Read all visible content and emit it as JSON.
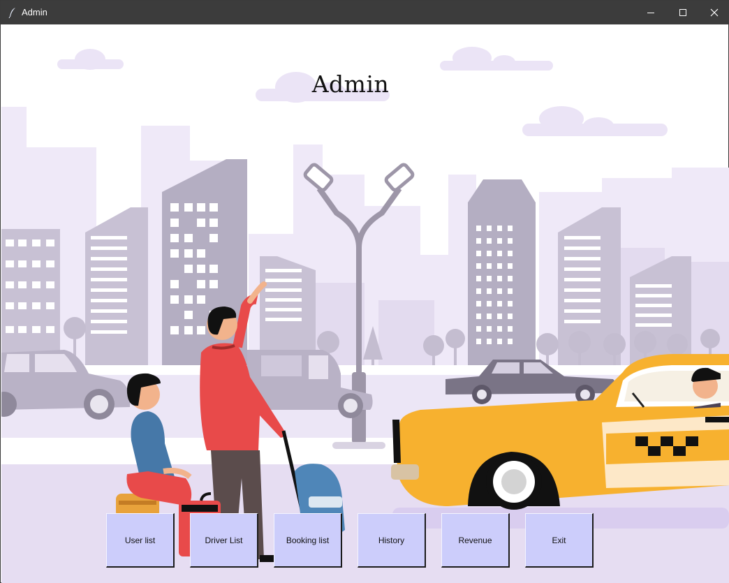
{
  "window": {
    "title": "Admin",
    "controls": {
      "minimize": "minimize-icon",
      "maximize": "maximize-icon",
      "close": "close-icon"
    }
  },
  "page": {
    "heading": "Admin"
  },
  "buttons": [
    {
      "label": "User list"
    },
    {
      "label": "Driver List"
    },
    {
      "label": "Booking list"
    },
    {
      "label": "History"
    },
    {
      "label": "Revenue"
    },
    {
      "label": "Exit"
    }
  ],
  "background": {
    "description_icon": "city-taxi-illustration",
    "colors": {
      "sky_building": "#ede6f7",
      "building_mid": "#b4aec2",
      "road": "#e6ddf2",
      "taxi": "#f7b12f",
      "accent_red": "#e84a4a",
      "button_bg": "#cccdfb"
    }
  }
}
